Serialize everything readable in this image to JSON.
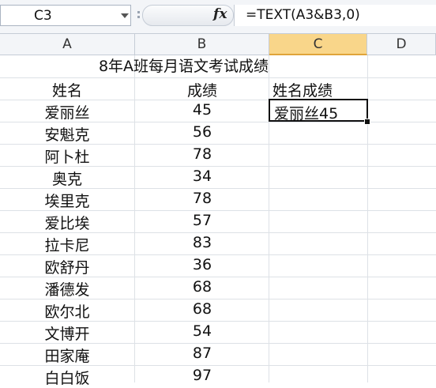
{
  "formula_bar": {
    "name_box": "C3",
    "fx_label": "fx",
    "formula": "=TEXT(A3&B3,0)"
  },
  "columns": [
    "A",
    "B",
    "C",
    "D"
  ],
  "sheet": {
    "title": "8年A班每月语文考试成绩",
    "header": {
      "name": "姓名",
      "score": "成绩",
      "combined": "姓名成绩"
    },
    "rows": [
      {
        "name": "爱丽丝",
        "score": "45"
      },
      {
        "name": "安魁克",
        "score": "56"
      },
      {
        "name": "阿卜杜",
        "score": "78"
      },
      {
        "name": "奥克",
        "score": "34"
      },
      {
        "name": "埃里克",
        "score": "78"
      },
      {
        "name": "爱比埃",
        "score": "57"
      },
      {
        "name": "拉卡尼",
        "score": "83"
      },
      {
        "name": "欧舒丹",
        "score": "36"
      },
      {
        "name": "潘德发",
        "score": "68"
      },
      {
        "name": "欧尔北",
        "score": "68"
      },
      {
        "name": "文博开",
        "score": "54"
      },
      {
        "name": "田家庵",
        "score": "87"
      },
      {
        "name": "白白饭",
        "score": "97"
      }
    ],
    "selected_value": "爱丽丝45"
  },
  "colors": {
    "selected_header": "#f9d68a",
    "grid": "#dde1e6"
  }
}
